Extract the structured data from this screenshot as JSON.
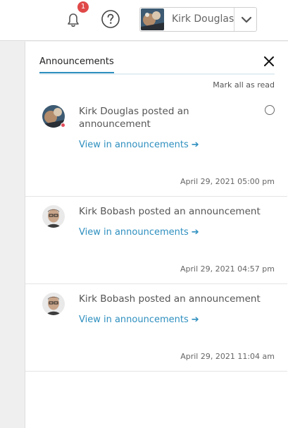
{
  "topbar": {
    "notification_count": "1",
    "user_name": "Kirk Douglas"
  },
  "panel": {
    "tab_label": "Announcements",
    "mark_all_label": "Mark all as read",
    "view_link_label": "View in announcements",
    "items": [
      {
        "message": "Kirk Douglas posted an announcement",
        "timestamp": "April 29, 2021 05:00 pm"
      },
      {
        "message": "Kirk Bobash posted an announcement",
        "timestamp": "April 29, 2021 04:57 pm"
      },
      {
        "message": "Kirk Bobash posted an announcement",
        "timestamp": "April 29, 2021 11:04 am"
      }
    ]
  },
  "colors": {
    "accent": "#2e8fbf",
    "badge": "#e04848"
  }
}
